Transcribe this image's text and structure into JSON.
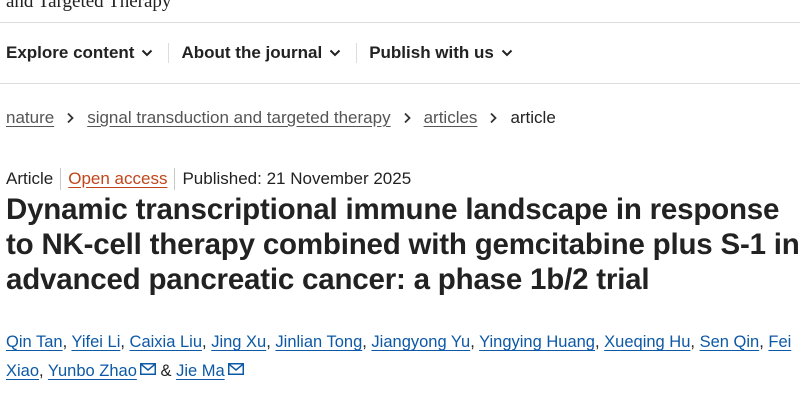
{
  "journal": {
    "name": "and Targeted Therapy"
  },
  "nav": {
    "items": [
      {
        "label": "Explore content"
      },
      {
        "label": "About the journal"
      },
      {
        "label": "Publish with us"
      }
    ]
  },
  "breadcrumb": {
    "items": [
      {
        "label": "nature"
      },
      {
        "label": "signal transduction and targeted therapy"
      },
      {
        "label": "articles"
      }
    ],
    "current": "article"
  },
  "article": {
    "type": "Article",
    "access": "Open access",
    "published": "Published: 21 November 2025",
    "title": "Dynamic transcriptional immune landscape in response to NK-cell therapy combined with gemcitabine plus S-1 in advanced pancreatic cancer: a phase 1b/2 trial",
    "authors": [
      "Qin Tan",
      "Yifei Li",
      "Caixia Liu",
      "Jing Xu",
      "Jinlian Tong",
      "Jiangyong Yu",
      "Yingying Huang",
      "Xueqing Hu",
      "Sen Qin",
      "Fei Xiao",
      "Yunbo Zhao",
      "Jie Ma"
    ],
    "author_separator": ", ",
    "last_separator": " & "
  },
  "colors": {
    "link": "#0d59a6",
    "open_access": "#c0461b",
    "text": "#222222"
  },
  "icons": {
    "nav_chevron": "chevron-down-icon",
    "breadcrumb_separator": "chevron-right-icon",
    "author_contact": "envelope-icon"
  }
}
